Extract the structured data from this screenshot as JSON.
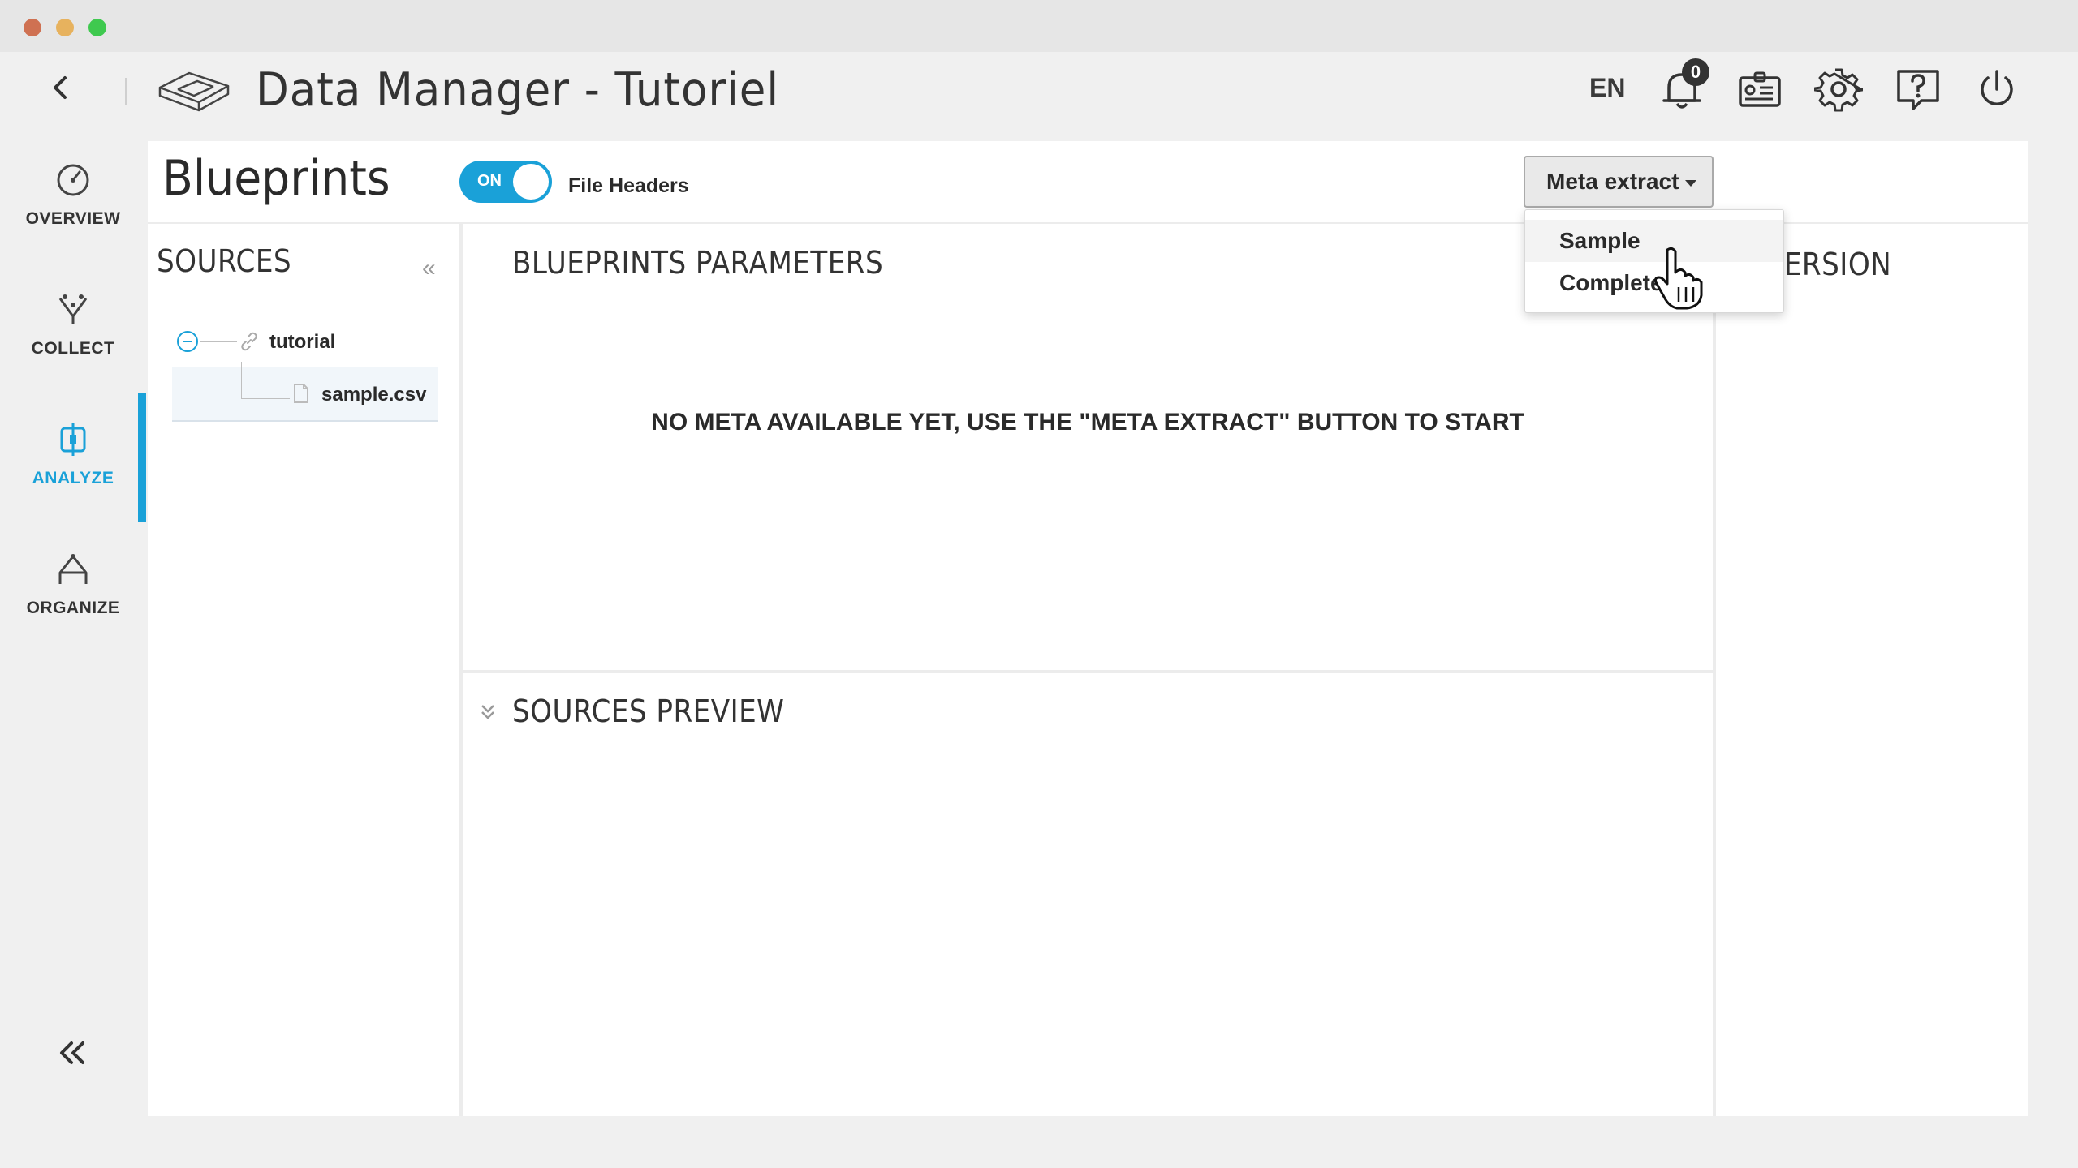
{
  "window": {
    "title": "Data Manager - Tutoriel"
  },
  "header": {
    "language": "EN",
    "notifications_count": "0",
    "icons": [
      "back-icon",
      "logo-icon",
      "bell-icon",
      "badge-card-icon",
      "gear-icon",
      "help-icon",
      "power-icon"
    ]
  },
  "sidebar": {
    "items": [
      {
        "label": "OVERVIEW",
        "icon": "gauge-icon",
        "active": false
      },
      {
        "label": "COLLECT",
        "icon": "funnel-icon",
        "active": false
      },
      {
        "label": "ANALYZE",
        "icon": "analyze-icon",
        "active": true
      },
      {
        "label": "ORGANIZE",
        "icon": "network-icon",
        "active": false
      }
    ],
    "collapse_icon": "double-chevron-left-icon"
  },
  "page": {
    "title": "Blueprints",
    "toggle": {
      "state_label": "ON",
      "label": "File Headers"
    },
    "meta_button": {
      "label": "Meta extract"
    },
    "dropdown": {
      "items": [
        "Sample",
        "Complete"
      ],
      "hovered": "Sample"
    }
  },
  "sources": {
    "title": "SOURCES",
    "collapse_label": "«",
    "tree": {
      "root": "tutorial",
      "children": [
        "sample.csv"
      ]
    }
  },
  "parameters": {
    "title": "BLUEPRINTS PARAMETERS",
    "empty_message": "NO META AVAILABLE YET, USE THE \"META EXTRACT\" BUTTON TO START"
  },
  "preview": {
    "title": "SOURCES PREVIEW",
    "chevron": "»"
  },
  "right_panel": {
    "title_partial": "VERSION"
  },
  "colors": {
    "accent": "#1aa1d8",
    "background": "#f0f0f0",
    "card": "#ffffff"
  }
}
